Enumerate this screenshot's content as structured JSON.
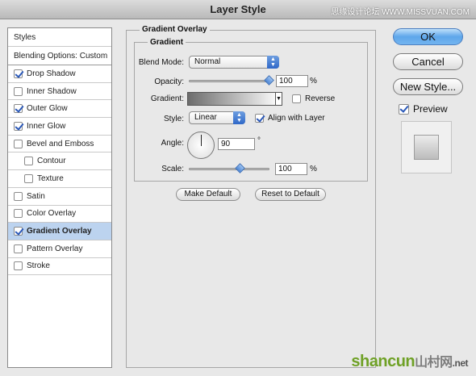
{
  "window": {
    "title": "Layer Style",
    "watermark_top": "思缘设计论坛 WWW.MISSVUAN.COM"
  },
  "sidebar": {
    "header": "Styles",
    "blending": "Blending Options: Custom",
    "items": [
      {
        "label": "Drop Shadow",
        "checked": true,
        "sub": false,
        "selected": false
      },
      {
        "label": "Inner Shadow",
        "checked": false,
        "sub": false,
        "selected": false
      },
      {
        "label": "Outer Glow",
        "checked": true,
        "sub": false,
        "selected": false
      },
      {
        "label": "Inner Glow",
        "checked": true,
        "sub": false,
        "selected": false
      },
      {
        "label": "Bevel and Emboss",
        "checked": false,
        "sub": false,
        "selected": false
      },
      {
        "label": "Contour",
        "checked": false,
        "sub": true,
        "selected": false
      },
      {
        "label": "Texture",
        "checked": false,
        "sub": true,
        "selected": false
      },
      {
        "label": "Satin",
        "checked": false,
        "sub": false,
        "selected": false
      },
      {
        "label": "Color Overlay",
        "checked": false,
        "sub": false,
        "selected": false
      },
      {
        "label": "Gradient Overlay",
        "checked": true,
        "sub": false,
        "selected": true
      },
      {
        "label": "Pattern Overlay",
        "checked": false,
        "sub": false,
        "selected": false
      },
      {
        "label": "Stroke",
        "checked": false,
        "sub": false,
        "selected": false
      }
    ]
  },
  "panel": {
    "title": "Gradient Overlay",
    "group_title": "Gradient",
    "blend_mode_label": "Blend Mode:",
    "blend_mode_value": "Normal",
    "opacity_label": "Opacity:",
    "opacity_value": "100",
    "opacity_unit": "%",
    "gradient_label": "Gradient:",
    "reverse_label": "Reverse",
    "reverse_checked": false,
    "style_label": "Style:",
    "style_value": "Linear",
    "align_label": "Align with Layer",
    "align_checked": true,
    "angle_label": "Angle:",
    "angle_value": "90",
    "angle_unit": "°",
    "scale_label": "Scale:",
    "scale_value": "100",
    "scale_unit": "%",
    "make_default": "Make Default",
    "reset_default": "Reset to Default"
  },
  "buttons": {
    "ok": "OK",
    "cancel": "Cancel",
    "new_style": "New Style...",
    "preview_label": "Preview",
    "preview_checked": true
  },
  "watermark": {
    "brand": "shancun",
    "cn": "山村网",
    "tld": ".net"
  },
  "colors": {
    "selection": "#bcd3ef",
    "accent": "#2f68c8"
  }
}
